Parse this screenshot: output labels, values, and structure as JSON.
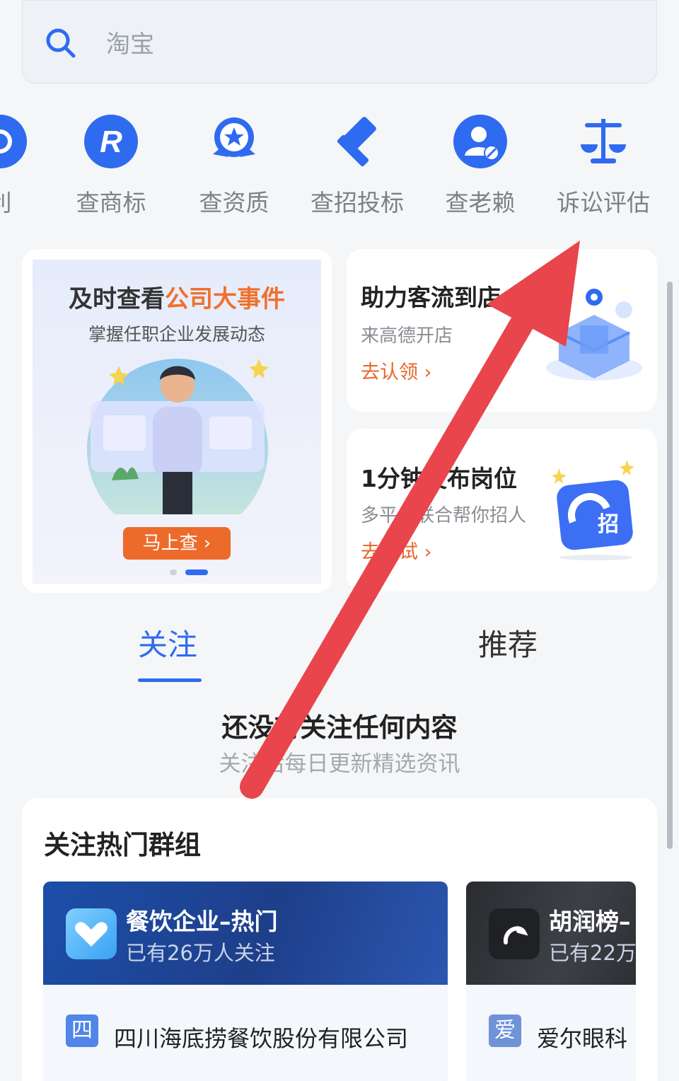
{
  "search": {
    "placeholder": "淘宝"
  },
  "tools": [
    {
      "label": "利",
      "icon": "partial-icon"
    },
    {
      "label": "查商标",
      "icon": "trademark-icon"
    },
    {
      "label": "查资质",
      "icon": "award-icon"
    },
    {
      "label": "查招投标",
      "icon": "gavel-icon"
    },
    {
      "label": "查老赖",
      "icon": "blocked-user-icon"
    },
    {
      "label": "诉讼评估",
      "icon": "scales-icon"
    }
  ],
  "banner": {
    "title_plain": "及时查看",
    "title_highlight": "公司大事件",
    "subtitle": "掌握任职企业发展动态",
    "button": "马上查 ›"
  },
  "promos": [
    {
      "title": "助力客流到店",
      "subtitle": "来高德开店",
      "link": "去认领 ›"
    },
    {
      "title": "1分钟发布岗位",
      "subtitle": "多平台联合帮你招人",
      "link": "去试试 ›",
      "badge": "招"
    }
  ],
  "tabs": [
    {
      "label": "关注",
      "active": true
    },
    {
      "label": "推荐",
      "active": false
    }
  ],
  "empty_state": {
    "title": "还没有关注任何内容",
    "subtitle": "关注后每日更新精选资讯"
  },
  "groups": {
    "title": "关注热门群组",
    "items": [
      {
        "name": "餐饮企业–热门",
        "followers": "已有26万人关注",
        "badge": "四",
        "company": "四川海底捞餐饮股份有限公司"
      },
      {
        "name": "胡润榜–",
        "followers": "已有22万",
        "badge": "爱",
        "company": "爱尔眼科"
      }
    ]
  },
  "colors": {
    "accent": "#2f6bf0",
    "orange": "#ec6a2a",
    "arrow": "#e8454c"
  }
}
